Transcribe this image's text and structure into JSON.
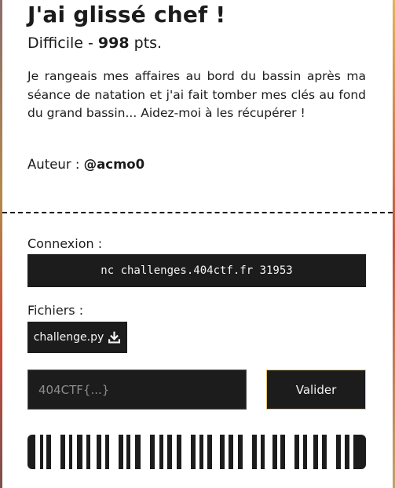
{
  "challenge": {
    "title": "J'ai glissé chef !",
    "difficulty": "Difficile",
    "separator": " - ",
    "points": "998",
    "points_suffix": " pts.",
    "description": "Je rangeais mes affaires au bord du bassin après ma séance de natation et j'ai fait tomber mes clés au fond du grand bassin... Aidez-moi à les récupérer !",
    "author_label": "Auteur : ",
    "author_name": "@acmo0"
  },
  "connection": {
    "label": "Connexion :",
    "command": "nc challenges.404ctf.fr 31953"
  },
  "files": {
    "label": "Fichiers :",
    "items": [
      {
        "name": "challenge.py",
        "icon": "download-icon"
      }
    ]
  },
  "flag_form": {
    "placeholder": "404CTF{...}",
    "value": "",
    "submit_label": "Valider"
  },
  "colors": {
    "panel": "#1c1c1c",
    "card": "#ffffff",
    "accent_border": "#e7c766",
    "text": "#1b1b1b"
  }
}
